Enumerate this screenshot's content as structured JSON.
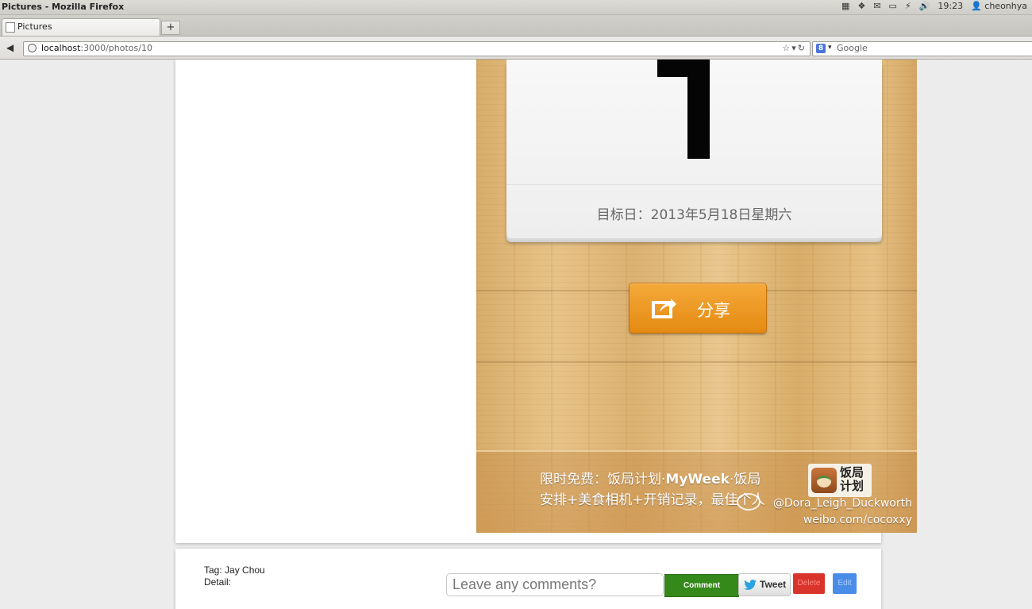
{
  "window": {
    "title": "Pictures - Mozilla Firefox"
  },
  "system_panel": {
    "icons": [
      "keyboard-icon",
      "dropbox-icon",
      "mail-icon",
      "battery-icon",
      "bluetooth-icon",
      "volume-icon",
      "user-icon"
    ],
    "time": "19:23",
    "user": "cheonhya"
  },
  "tab": {
    "title": "Pictures",
    "new_tab_label": "+"
  },
  "nav": {
    "back_label": "◀",
    "url_host": "localhost",
    "url_path": ":3000/photos/10",
    "url_controls": "☆▾↻",
    "search_engine": "8",
    "search_dropdown": "▾",
    "search_placeholder": "Google"
  },
  "photo": {
    "calendar_date": "目标日：2013年5月18日星期六",
    "share_label": "分享",
    "banner_line1_pre": "限时免费：饭局计划·",
    "banner_line1_bold": "MyWeek",
    "banner_line1_post": "·饭局",
    "banner_line2": "安排+美食相机+开销记录，最佳个人",
    "app_logo_text": "饭局计划",
    "watermark_user": "@Dora_Leigh_Duckworth",
    "watermark_url": "weibo.com/cocoxxy"
  },
  "info": {
    "tag": "Tag: Jay Chou",
    "detail": "Detail:",
    "comment_placeholder": "Leave any comments?",
    "comment_button": "Comment",
    "tweet_button": "Tweet",
    "delete_button": "Delete",
    "edit_button": "Edit"
  },
  "colors": {
    "comment_green": "#34891a",
    "delete_red": "#d9342b",
    "edit_blue": "#4a8de8",
    "share_orange": "#ef9b25"
  }
}
